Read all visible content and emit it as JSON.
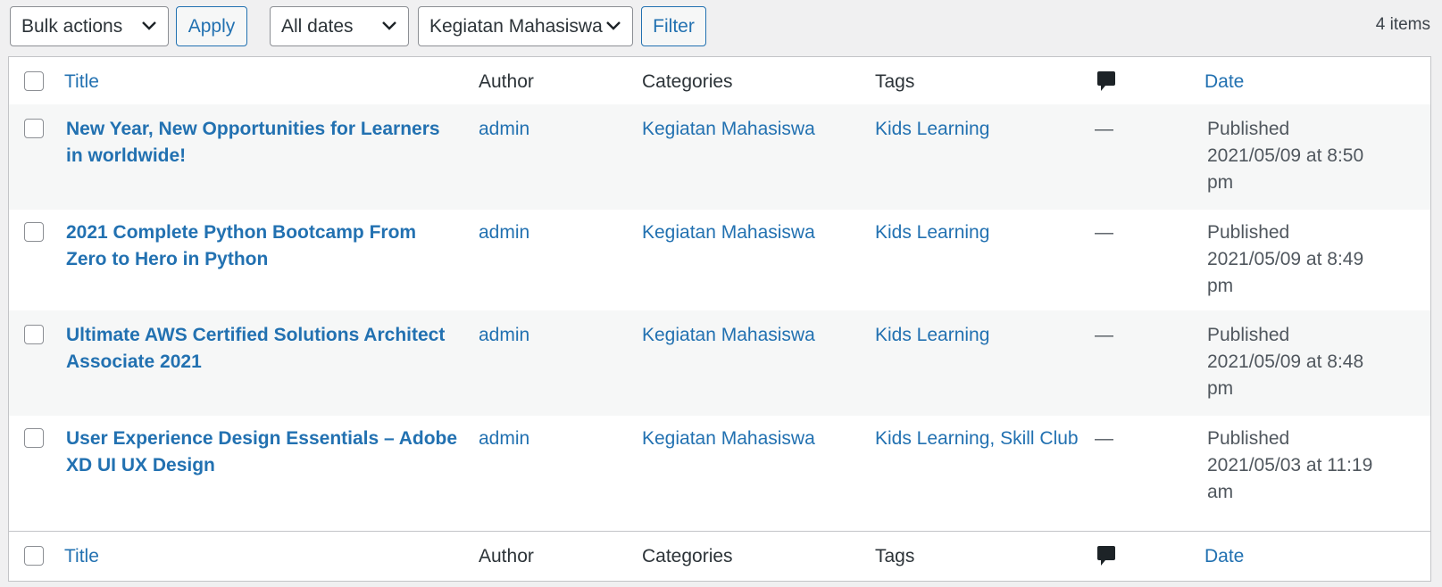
{
  "toolbar": {
    "bulk_actions": "Bulk actions",
    "apply": "Apply",
    "dates": "All dates",
    "category": "Kegiatan Mahasiswa",
    "filter": "Filter",
    "items_count": "4 items"
  },
  "columns": {
    "title": "Title",
    "author": "Author",
    "categories": "Categories",
    "tags": "Tags",
    "date": "Date"
  },
  "rows": [
    {
      "title": "New Year, New Opportunities for Learners in worldwide!",
      "author": "admin",
      "category": "Kegiatan Mahasiswa",
      "tags": "Kids Learning",
      "comments": "—",
      "date": "Published 2021/05/09 at 8:50 pm"
    },
    {
      "title": "2021 Complete Python Bootcamp From Zero to Hero in Python",
      "author": "admin",
      "category": "Kegiatan Mahasiswa",
      "tags": "Kids Learning",
      "comments": "—",
      "date": "Published 2021/05/09 at 8:49 pm"
    },
    {
      "title": "Ultimate AWS Certified Solutions Architect Associate 2021",
      "author": "admin",
      "category": "Kegiatan Mahasiswa",
      "tags": "Kids Learning",
      "comments": "—",
      "date": "Published 2021/05/09 at 8:48 pm"
    },
    {
      "title": "User Experience Design Essentials – Adobe XD UI UX Design",
      "author": "admin",
      "category": "Kegiatan Mahasiswa",
      "tags": "Kids Learning, Skill Club",
      "comments": "—",
      "date": "Published 2021/05/03 at 11:19 am"
    }
  ],
  "colors": {
    "link": "#2271b1",
    "border": "#c3c4c7",
    "background": "#f0f0f1"
  }
}
